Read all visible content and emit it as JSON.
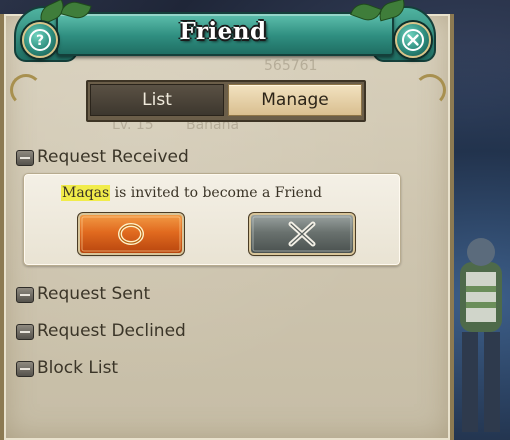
{
  "window": {
    "title": "Friend",
    "help_icon": "question-mark-icon",
    "close_icon": "close-x-icon",
    "faded_background_text": [
      "565761",
      "Lv. 15",
      "Banana"
    ]
  },
  "tabs": [
    {
      "label": "List",
      "active": false
    },
    {
      "label": "Manage",
      "active": true
    }
  ],
  "sections": {
    "received": {
      "label": "Request Received",
      "expanded": true
    },
    "sent": {
      "label": "Request Sent",
      "expanded": false
    },
    "declined": {
      "label": "Request Declined",
      "expanded": false
    },
    "block": {
      "label": "Block List",
      "expanded": false
    }
  },
  "invitation": {
    "name": "Maqas",
    "message": " is invited to become a Friend",
    "accept_icon": "circle-o-icon",
    "decline_icon": "x-cross-icon"
  },
  "colors": {
    "banner": "#2f8e80",
    "accept": "#e16a1f",
    "decline": "#6a726f",
    "name_highlight": "#f1ec4a",
    "parchment": "#d9d1bd"
  }
}
